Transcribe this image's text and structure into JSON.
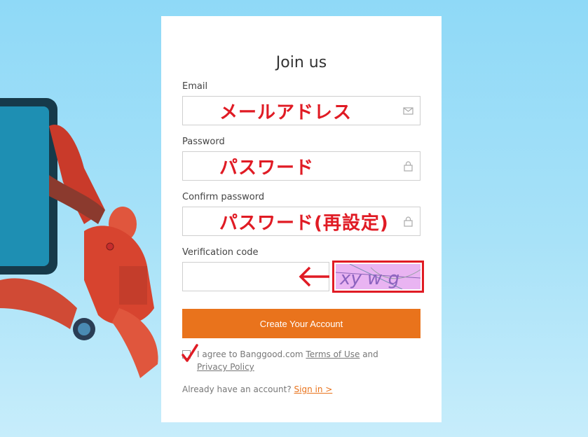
{
  "form": {
    "title": "Join us",
    "email": {
      "label": "Email",
      "annotation": "メールアドレス",
      "icon": "envelope-icon"
    },
    "password": {
      "label": "Password",
      "annotation": "パスワード",
      "icon": "lock-icon"
    },
    "confirm_password": {
      "label": "Confirm password",
      "annotation": "パスワード(再設定)",
      "icon": "lock-icon"
    },
    "verification": {
      "label": "Verification code"
    },
    "create_button": "Create Your Account",
    "agree": {
      "prefix": "I agree to Banggood.com ",
      "terms_link": "Terms of Use",
      "middle": " and ",
      "privacy_link": "Privacy Policy"
    },
    "signin": {
      "text": "Already have an account? ",
      "link": "Sign in >"
    }
  },
  "captcha": {
    "text": "xy w g"
  },
  "colors": {
    "accent": "#e9731c",
    "annotation_red": "#e01b24"
  }
}
